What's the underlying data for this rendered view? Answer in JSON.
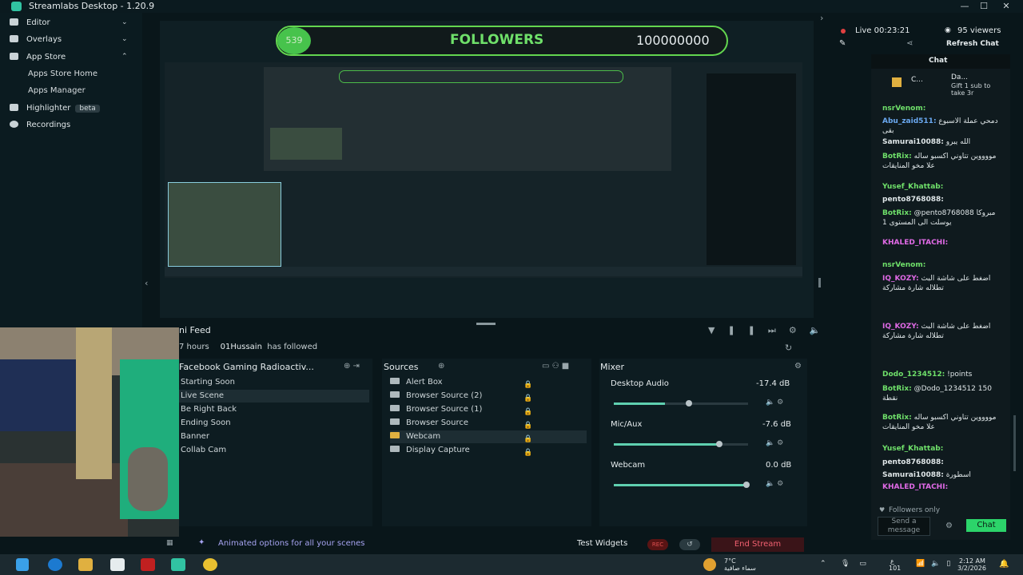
{
  "window": {
    "title": "Streamlabs Desktop - 1.20.9",
    "controls": [
      "—",
      "☐",
      "✕"
    ]
  },
  "sidebar": {
    "items": [
      {
        "label": "Editor"
      },
      {
        "label": "Overlays"
      },
      {
        "label": "App Store"
      },
      {
        "label": "Apps Store Home"
      },
      {
        "label": "Apps Manager"
      },
      {
        "label": "Highlighter",
        "badge": "beta"
      },
      {
        "label": "Recordings"
      }
    ]
  },
  "preview": {
    "followers_count": "539",
    "followers_label": "FOLLOWERS",
    "followers_goal": "100000000"
  },
  "mini_feed": {
    "title": "ni Feed",
    "event": {
      "time": "7 hours",
      "name": "01Hussain",
      "action": "has followed"
    }
  },
  "scenes": {
    "title": "Facebook Gaming Radioactiv...",
    "items": [
      "Starting Soon",
      "Live Scene",
      "Be Right Back",
      "Ending Soon",
      "Banner",
      "Collab Cam"
    ],
    "selected": "Live Scene"
  },
  "sources": {
    "title": "Sources",
    "items": [
      "Alert Box",
      "Browser Source (2)",
      "Browser Source (1)",
      "Browser Source",
      "Webcam",
      "Display Capture"
    ],
    "selected": "Webcam"
  },
  "mixer": {
    "title": "Mixer",
    "channels": [
      {
        "name": "Desktop Audio",
        "db": "-17.4 dB",
        "level": 0.38
      },
      {
        "name": "Mic/Aux",
        "db": "-7.6 dB",
        "level": 0.78
      },
      {
        "name": "Webcam",
        "db": "0.0 dB",
        "level": 1.0
      }
    ]
  },
  "footer": {
    "info": "Animated options for all your scenes",
    "test_widgets": "Test Widgets",
    "rec": "REC",
    "end_stream": "End Stream"
  },
  "stream_top": {
    "live": "Live 00:23:21",
    "viewers": "95 viewers",
    "refresh": "Refresh Chat",
    "chat_tab": "Chat"
  },
  "chat": {
    "pinned": {
      "left": "C...",
      "name": "Da...",
      "text": "Gift 1 sub to take 3r"
    },
    "messages": [
      {
        "user": "nsrVenom:",
        "text": "",
        "color": "u-green"
      },
      {
        "user": "Abu_zaid511:",
        "text": "دمحي عملة الاسبوع بقى",
        "color": "u-blue"
      },
      {
        "user": "Samurai10088:",
        "text": "الله يبرو",
        "color": "u-white"
      },
      {
        "user": "BotRix:",
        "text": "مووووين تتاوني اكسبو ساله علا مخو المنايقات",
        "color": "u-green"
      },
      {
        "user": "Yusef_Khattab:",
        "text": "",
        "color": "u-green"
      },
      {
        "user": "pento8768088:",
        "text": "",
        "color": "u-white"
      },
      {
        "user": "BotRix:",
        "text": "@pento8768088 مبروكا يوسلت الى المستوى 1",
        "color": "u-green"
      },
      {
        "user": "KHALED_ITACHI:",
        "text": "",
        "color": "u-pink"
      },
      {
        "user": "nsrVenom:",
        "text": "",
        "color": "u-green"
      },
      {
        "user": "IQ_KOZY:",
        "text": "اضغط على شاشة البث تطلاله شارة مشاركة",
        "color": "u-pink"
      },
      {
        "user": "IQ_KOZY:",
        "text": "اضغط على شاشة البث تطلاله شارة مشاركة",
        "color": "u-pink"
      },
      {
        "user": "Dodo_1234512:",
        "text": "!points",
        "color": "u-green"
      },
      {
        "user": "BotRix:",
        "text": "@Dodo_1234512 150 نقطة",
        "color": "u-green"
      },
      {
        "user": "BotRix:",
        "text": "مووووين تتاوني اكسبو ساله علا مخو المنايقات",
        "color": "u-green"
      },
      {
        "user": "Yusef_Khattab:",
        "text": "",
        "color": "u-green"
      },
      {
        "user": "pento8768088:",
        "text": "",
        "color": "u-white"
      },
      {
        "user": "Samurai10088:",
        "text": "اسطورة",
        "color": "u-white"
      },
      {
        "user": "KHALED_ITACHI:",
        "text": "",
        "color": "u-pink"
      }
    ],
    "followers_only": "Followers only",
    "input_placeholder": "Send a message",
    "send_label": "Chat"
  },
  "taskbar": {
    "weather": {
      "temp": "7°C",
      "desc": "سماء صافية"
    },
    "lang": "ع",
    "lang2": "101",
    "time": "2:12 AM",
    "date": "3/2/2026"
  },
  "colors": {
    "accent": "#31c3a2",
    "green": "#6fe06a",
    "end_stream": "#f06070"
  }
}
